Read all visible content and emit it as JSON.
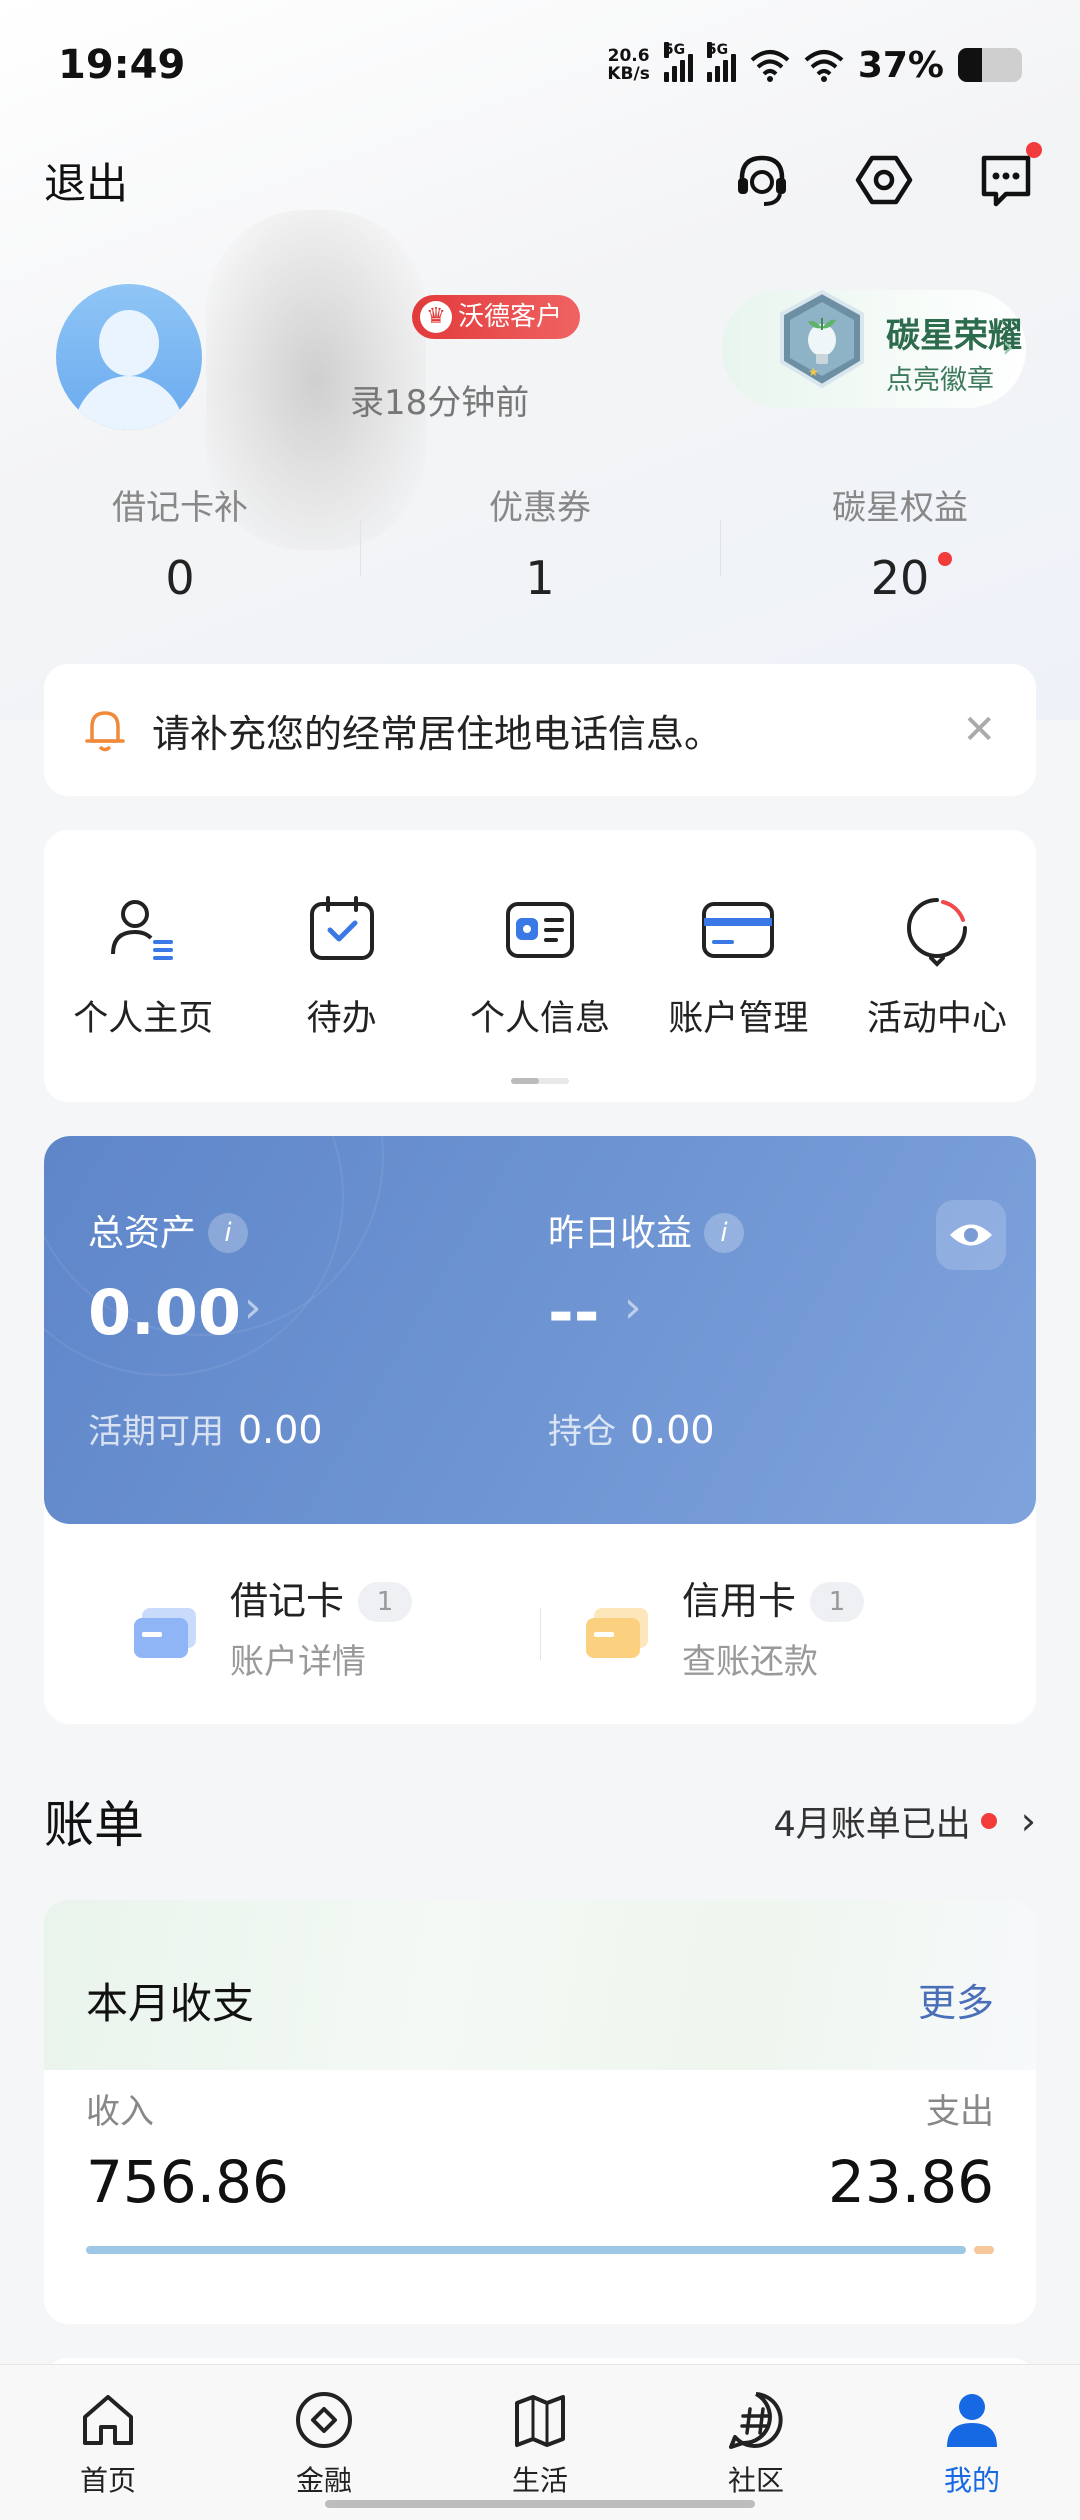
{
  "status_bar": {
    "time": "19:49",
    "net_speed_value": "20.6",
    "net_speed_unit": "KB/s",
    "network_1": "5G",
    "network_2": "5G",
    "battery_text": "37%",
    "battery_level": 0.37
  },
  "header": {
    "logout_label": "退出",
    "icons": [
      "customer-service-icon",
      "settings-hexagon-icon",
      "message-icon"
    ],
    "message_has_unread": true
  },
  "profile": {
    "badge": "沃德客户",
    "last_login": "录18分钟前",
    "carbon": {
      "title": "碳星荣耀",
      "subtitle": "点亮徽章"
    }
  },
  "stats": [
    {
      "label": "借记卡补",
      "value": "0"
    },
    {
      "label": "优惠券",
      "value": "1"
    },
    {
      "label": "碳星权益",
      "value": "20",
      "has_dot": true
    }
  ],
  "notice": {
    "text": "请补充您的经常居住地电话信息。"
  },
  "quick_actions": [
    {
      "label": "个人主页",
      "icon": "person-list-icon"
    },
    {
      "label": "待办",
      "icon": "calendar-check-icon"
    },
    {
      "label": "个人信息",
      "icon": "id-card-icon"
    },
    {
      "label": "账户管理",
      "icon": "bank-card-icon"
    },
    {
      "label": "活动中心",
      "icon": "activity-circle-icon"
    }
  ],
  "assets": {
    "total_label": "总资产",
    "total_value": "0.00",
    "yesterday_label": "昨日收益",
    "yesterday_value": "--",
    "available_label": "活期可用",
    "available_value": "0.00",
    "holding_label": "持仓",
    "holding_value": "0.00",
    "info_glyph": "i",
    "accent_color": "#6a90d0"
  },
  "cards": [
    {
      "name": "借记卡",
      "count": "1",
      "sub": "账户详情",
      "icon": "debit-card-icon"
    },
    {
      "name": "信用卡",
      "count": "1",
      "sub": "查账还款",
      "icon": "credit-card-icon"
    }
  ],
  "bill": {
    "title": "账单",
    "status": "4月账单已出"
  },
  "month": {
    "title": "本月收支",
    "more": "更多",
    "income_label": "收入",
    "income_value": "756.86",
    "expense_label": "支出",
    "expense_value": "23.86"
  },
  "tabbar": [
    {
      "label": "首页",
      "icon": "home-icon"
    },
    {
      "label": "金融",
      "icon": "finance-diamond-icon"
    },
    {
      "label": "生活",
      "icon": "life-ticket-icon"
    },
    {
      "label": "社区",
      "icon": "community-hash-icon"
    },
    {
      "label": "我的",
      "icon": "profile-person-icon",
      "active": true
    }
  ],
  "colors": {
    "active_tab": "#1668e3",
    "notify_dot": "#f23b3b",
    "income_bar": "#9cc8e6",
    "expense_bar": "#f6c79a"
  }
}
